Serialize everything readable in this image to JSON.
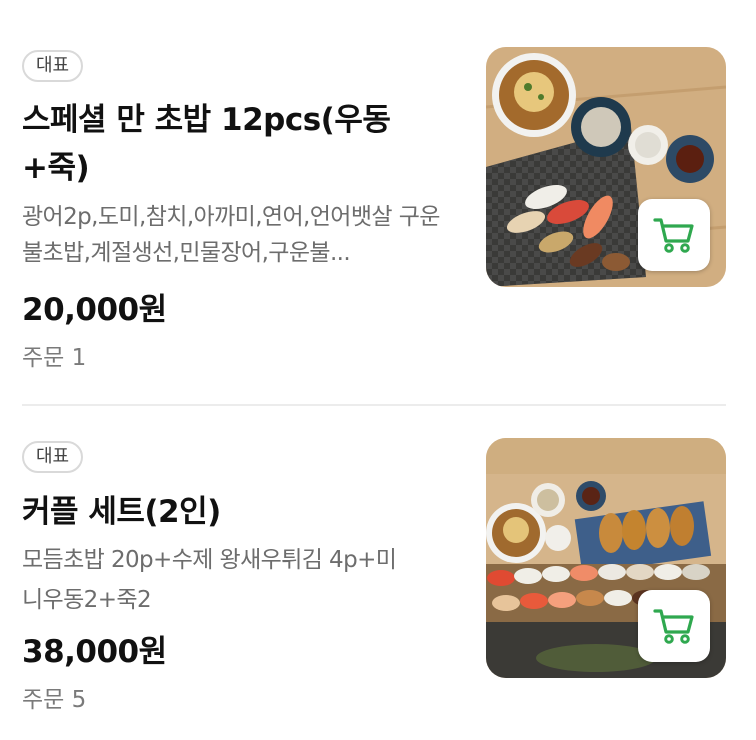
{
  "colors": {
    "cart_green": "#2fa84f",
    "badge_border": "#d9d9d9",
    "divider": "#ececec"
  },
  "items": [
    {
      "badge": "대표",
      "title_line1": "스페셜 만 초밥 12pcs(우동",
      "title_line2": "+죽)",
      "description": "광어2p,도미,참치,아까미,연어,언어뱃살 구운불초밥,계절생선,민물장어,구운불...",
      "price": "20,000원",
      "orders": "주문 1",
      "image_icon": "sushi-set-photo",
      "cart_icon": "shopping-cart-icon"
    },
    {
      "badge": "대표",
      "title_line1": "커플 세트(2인)",
      "description_line1": "모듬초밥 20p+수제 왕새우튀김 4p+미",
      "description_line2": "니우동2+죽2",
      "price": "38,000원",
      "orders": "주문 5",
      "image_icon": "couple-set-photo",
      "cart_icon": "shopping-cart-icon"
    }
  ]
}
